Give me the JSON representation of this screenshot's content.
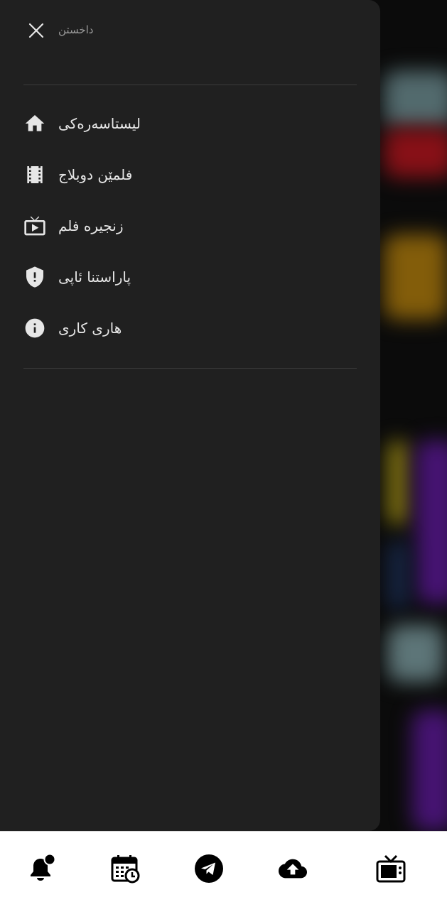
{
  "drawer": {
    "close_label": "داخستن",
    "items": [
      {
        "label": "لیستاسەرەکی",
        "icon": "home-icon"
      },
      {
        "label": "فلمێن دوبلاج",
        "icon": "film-icon"
      },
      {
        "label": "زنجیرە فلم",
        "icon": "tv-play-icon"
      },
      {
        "label": "پاراستنا ئاپی",
        "icon": "shield-icon"
      },
      {
        "label": "هاری کاری",
        "icon": "info-icon"
      }
    ]
  },
  "bottom_nav": {
    "items": [
      {
        "icon": "notification-bell-icon"
      },
      {
        "icon": "schedule-calendar-icon"
      },
      {
        "icon": "telegram-icon"
      },
      {
        "icon": "cloud-upload-icon"
      },
      {
        "icon": "tv-icon"
      }
    ]
  },
  "colors": {
    "drawer_bg": "#202020",
    "text": "#e6e6e6",
    "muted_text": "#9a9a9a",
    "nav_bg": "#ffffff"
  }
}
